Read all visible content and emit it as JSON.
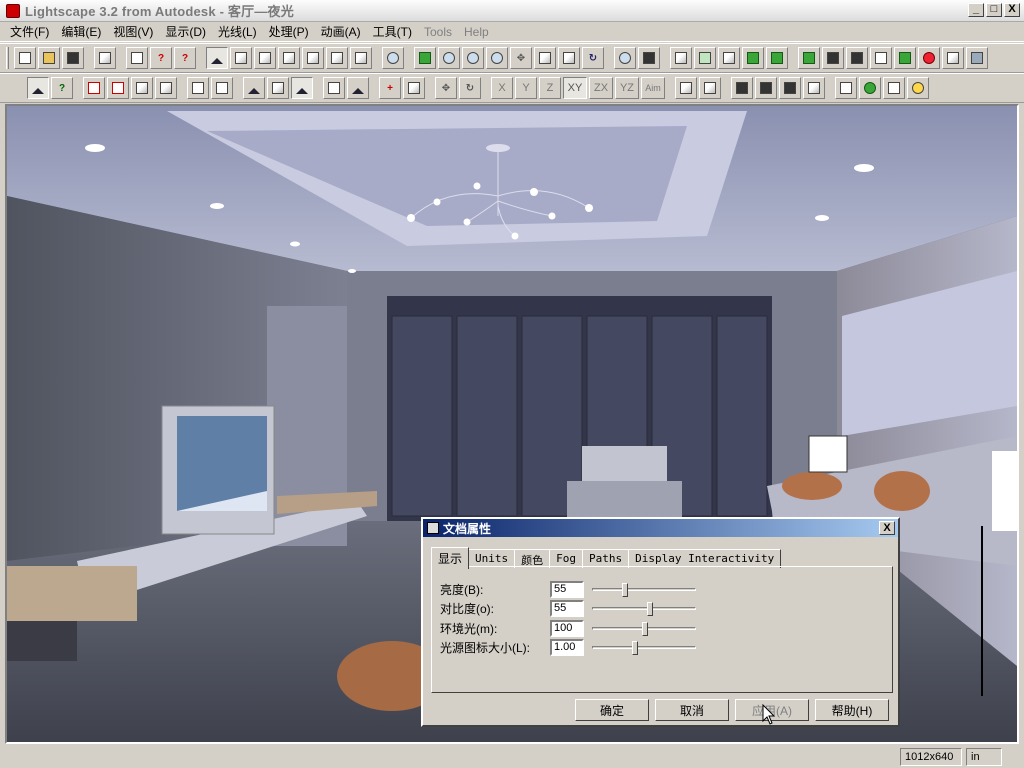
{
  "window": {
    "title": "Lightscape 3.2 from Autodesk - 客厅—夜光",
    "min_label": "_",
    "max_label": "□",
    "close_label": "X"
  },
  "menu": [
    {
      "label": "文件(F)",
      "dim": false
    },
    {
      "label": "编辑(E)",
      "dim": false
    },
    {
      "label": "视图(V)",
      "dim": false
    },
    {
      "label": "显示(D)",
      "dim": false
    },
    {
      "label": "光线(L)",
      "dim": false
    },
    {
      "label": "处理(P)",
      "dim": false
    },
    {
      "label": "动画(A)",
      "dim": false
    },
    {
      "label": "工具(T)",
      "dim": false
    },
    {
      "label": "Tools",
      "dim": true
    },
    {
      "label": "Help",
      "dim": true
    }
  ],
  "toolbar_axes": {
    "x": "X",
    "y": "Y",
    "z": "Z",
    "xy": "XY",
    "zx": "ZX",
    "yz": "YZ",
    "aim": "Aim"
  },
  "dialog": {
    "title": "文档属性",
    "close_label": "X",
    "tabs": [
      "显示",
      "Units",
      "颜色",
      "Fog",
      "Paths",
      "Display Interactivity"
    ],
    "active_tab": "显示",
    "fields": [
      {
        "label": "亮度(B):",
        "value": "55",
        "level": 0.3
      },
      {
        "label": "对比度(o):",
        "value": "55",
        "level": 0.55
      },
      {
        "label": "环境光(m):",
        "value": "100",
        "level": 0.5
      },
      {
        "label": "光源图标大小(L):",
        "value": "1.00",
        "level": 0.4
      }
    ],
    "buttons": {
      "ok": "确定",
      "cancel": "取消",
      "apply": "应用(A)",
      "help": "帮助(H)"
    }
  },
  "status": {
    "resolution": "1012x640",
    "units": "in"
  }
}
